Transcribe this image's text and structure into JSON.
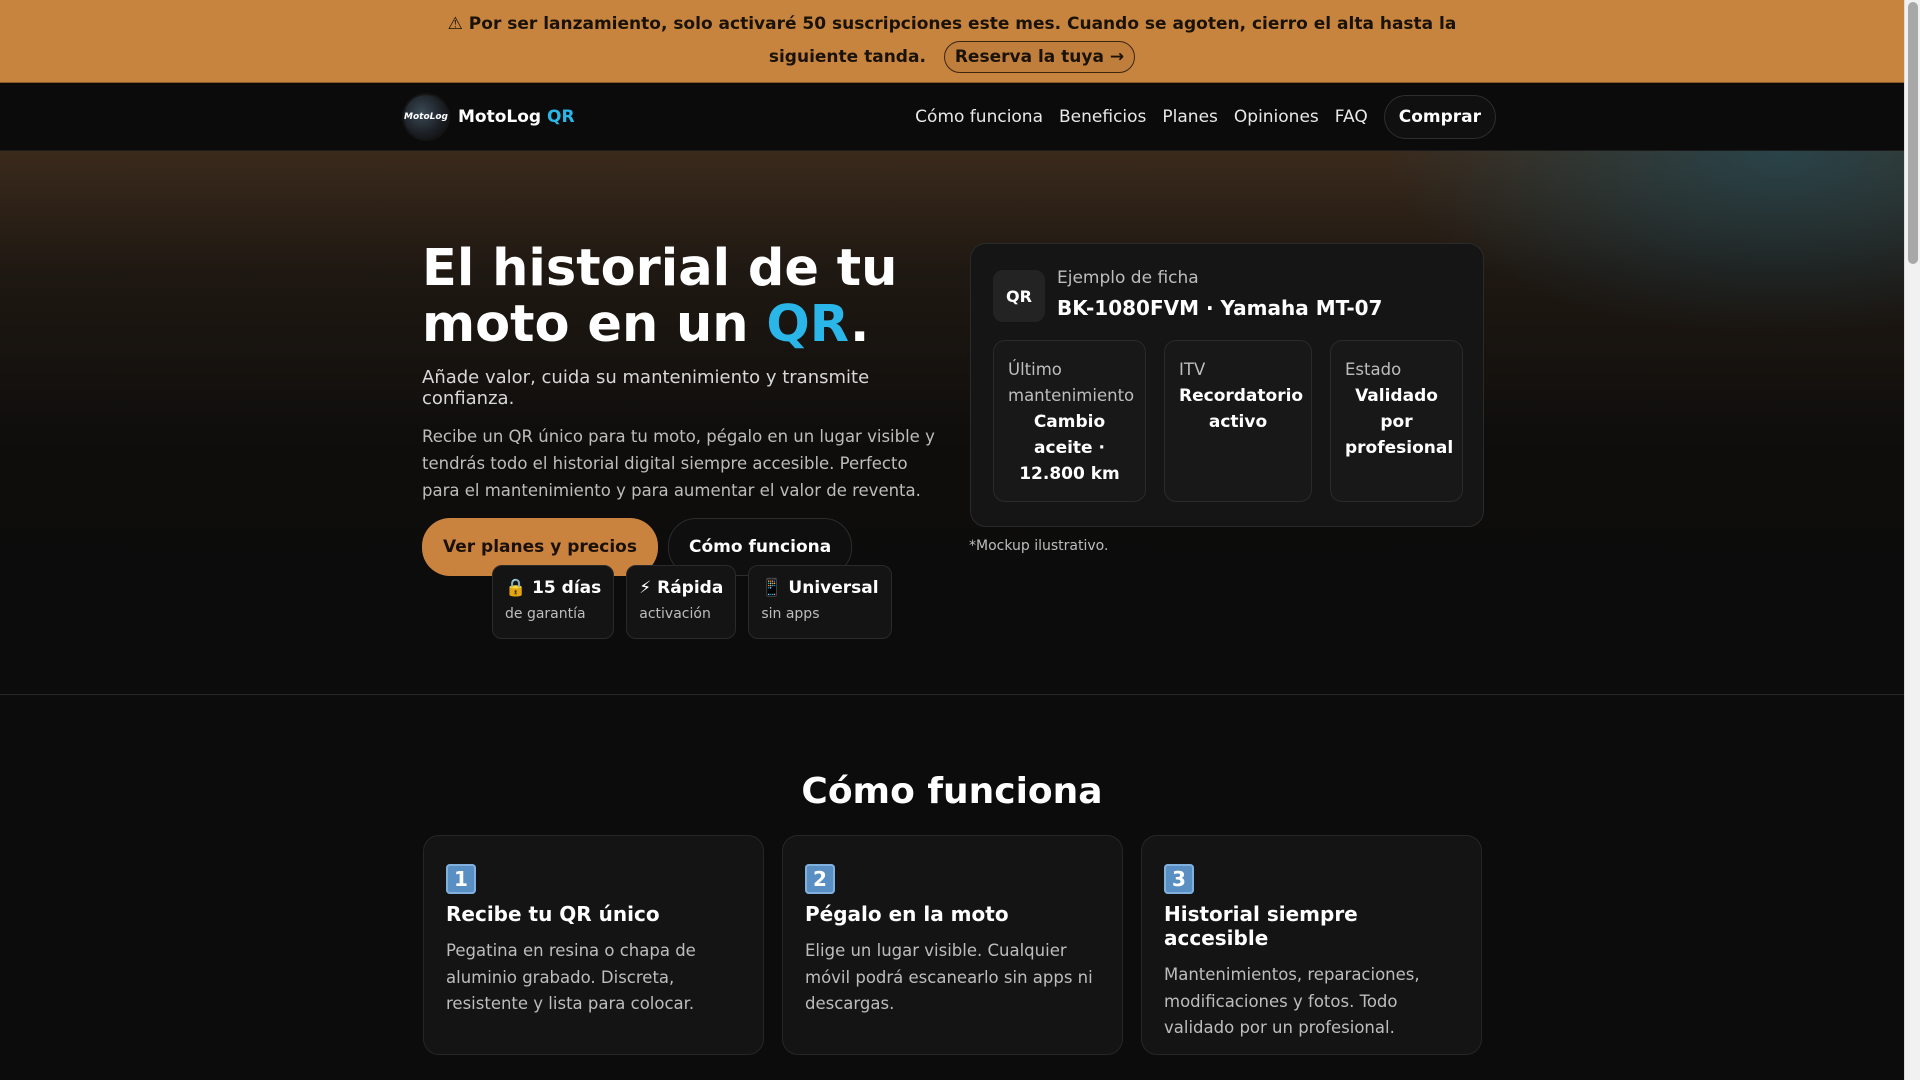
{
  "banner": {
    "text": "⚠ Por ser lanzamiento, solo activaré 50 suscripciones este mes. Cuando se agoten, cierro el alta hasta la siguiente tanda.",
    "cta": "Reserva la tuya →"
  },
  "nav": {
    "logo_text": "MotoLog",
    "brand_name": "MotoLog",
    "brand_accent": "QR",
    "links": [
      "Cómo funciona",
      "Beneficios",
      "Planes",
      "Opiniones",
      "FAQ"
    ],
    "buy": "Comprar"
  },
  "hero": {
    "title_line1": "El historial de tu",
    "title_line2_prefix": "moto en un ",
    "title_accent": "QR",
    "title_suffix": ".",
    "subtitle": "Añade valor, cuida su mantenimiento y transmite confianza.",
    "description": "Recibe un QR único para tu moto, pégalo en un lugar visible y tendrás todo el historial digital siempre accesible. Perfecto para el mantenimiento y para aumentar el valor de reventa.",
    "cta_primary": "Ver planes y precios",
    "cta_secondary": "Cómo funciona",
    "badges": [
      {
        "icon": "🔒",
        "title": "15 días",
        "sub": "de garantía"
      },
      {
        "icon": "⚡",
        "title": "Rápida",
        "sub": "activación"
      },
      {
        "icon": "📱",
        "title": "Universal",
        "sub": "sin apps"
      }
    ]
  },
  "mockup": {
    "chip": "QR",
    "label": "Ejemplo de ficha",
    "title": "BK-1080FVM · Yamaha MT-07",
    "cells": [
      {
        "label": "Último mantenimiento",
        "value": "Cambio aceite · 12.800 km"
      },
      {
        "label": "ITV",
        "value": "Recordatorio activo"
      },
      {
        "label": "Estado",
        "value": "Validado por profesional"
      }
    ],
    "note": "*Mockup ilustrativo."
  },
  "how": {
    "title": "Cómo funciona",
    "steps": [
      {
        "num": "1",
        "title": "Recibe tu QR único",
        "desc": "Pegatina en resina o chapa de aluminio grabado. Discreta, resistente y lista para colocar."
      },
      {
        "num": "2",
        "title": "Pégalo en la moto",
        "desc": "Elige un lugar visible. Cualquier móvil podrá escanearlo sin apps ni descargas."
      },
      {
        "num": "3",
        "title": "Historial siempre accesible",
        "desc": "Mantenimientos, reparaciones, modificaciones y fotos. Todo validado por un profesional."
      }
    ]
  },
  "colors": {
    "accent_orange": "#c9833f",
    "accent_blue": "#2ab6e8",
    "background": "#0c0c0c"
  }
}
